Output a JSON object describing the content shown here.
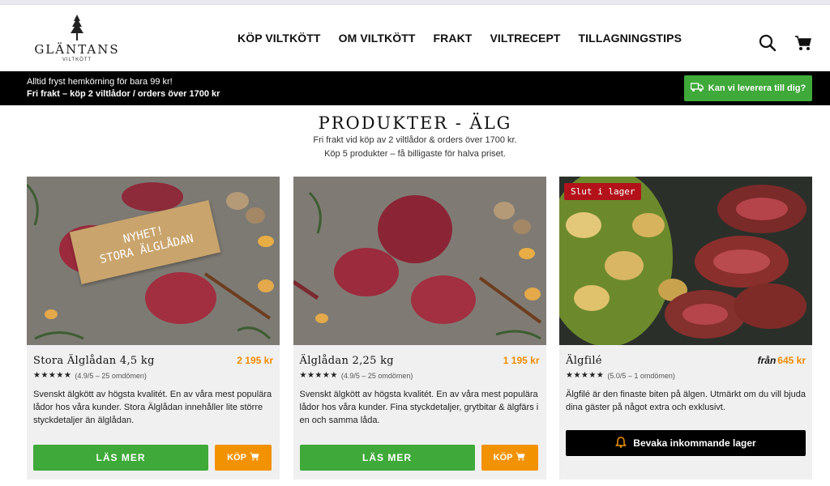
{
  "header": {
    "logo_brand": "GLÄNTANS",
    "logo_sub": "VILTKÖTT",
    "nav": [
      "KÖP VILTKÖTT",
      "OM VILTKÖTT",
      "FRAKT",
      "VILTRECEPT",
      "TILLAGNINGSTIPS"
    ]
  },
  "banner": {
    "line1": "Alltid fryst hemkörning för bara 99 kr!",
    "line2": "Fri frakt – köp 2 viltlådor / orders över 1700 kr",
    "deliver_button": "Kan vi leverera till dig?"
  },
  "page": {
    "title": "PRODUKTER - ÄLG",
    "sub1": "Fri frakt vid köp av 2 viltlådor & orders över 1700 kr.",
    "sub2": "Köp 5 produkter – få billigaste för halva priset."
  },
  "products": [
    {
      "name": "Stora Älglådan 4,5 kg",
      "price": "2 195 kr",
      "rating": "(4.9/5 – 25 omdömen)",
      "desc": "Svenskt älgkött av högsta kvalitét. En av våra mest populära lådor hos våra kunder. Stora Älglådan innehåller lite större styckdetaljer än älglådan.",
      "sign_line1": "NYHET!",
      "sign_line2": "STORA ÄLGLÅDAN",
      "more_label": "LÄS MER",
      "buy_label": "KÖP"
    },
    {
      "name": "Älglådan 2,25 kg",
      "price": "1 195 kr",
      "rating": "(4.9/5 – 25 omdömen)",
      "desc": "Svenskt älgkött av högsta kvalitét. En av våra mest populära lådor hos våra kunder. Fina styckdetaljer, grytbitar & älgfärs i en och samma låda.",
      "more_label": "LÄS MER",
      "buy_label": "KÖP"
    },
    {
      "name": "Älgfilé",
      "price_prefix": "från",
      "price": "645 kr",
      "rating": "(5.0/5 – 1 omdömen)",
      "desc": "Älgfilé är den finaste biten på älgen. Utmärkt om du vill bjuda dina gäster på något extra och exklusivt.",
      "badge": "Slut i lager",
      "watch_label": "Bevaka inkommande lager"
    }
  ],
  "stars": "★★★★★",
  "icons": [
    "search-icon",
    "cart-icon",
    "truck-icon",
    "bell-icon"
  ],
  "colors": {
    "green": "#3fa93a",
    "orange": "#f39200",
    "price": "#f08c00",
    "badge": "#b3121b"
  }
}
